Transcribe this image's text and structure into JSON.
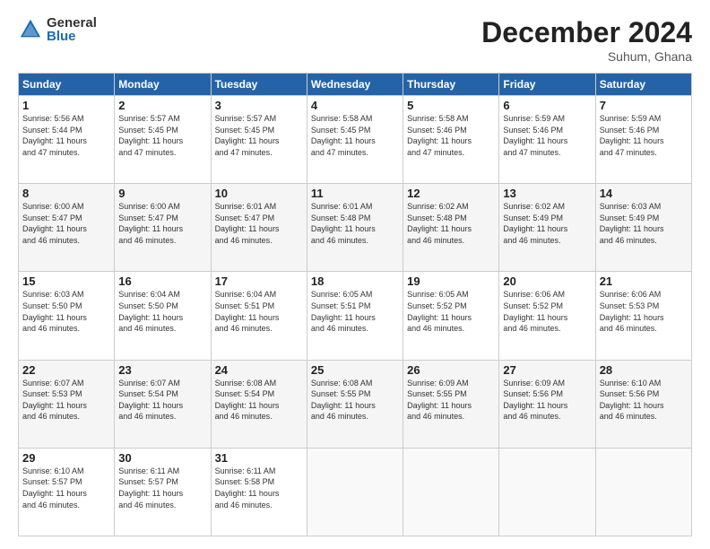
{
  "logo": {
    "general": "General",
    "blue": "Blue"
  },
  "header": {
    "month": "December 2024",
    "location": "Suhum, Ghana"
  },
  "weekdays": [
    "Sunday",
    "Monday",
    "Tuesday",
    "Wednesday",
    "Thursday",
    "Friday",
    "Saturday"
  ],
  "weeks": [
    [
      {
        "day": "1",
        "info": "Sunrise: 5:56 AM\nSunset: 5:44 PM\nDaylight: 11 hours\nand 47 minutes."
      },
      {
        "day": "2",
        "info": "Sunrise: 5:57 AM\nSunset: 5:45 PM\nDaylight: 11 hours\nand 47 minutes."
      },
      {
        "day": "3",
        "info": "Sunrise: 5:57 AM\nSunset: 5:45 PM\nDaylight: 11 hours\nand 47 minutes."
      },
      {
        "day": "4",
        "info": "Sunrise: 5:58 AM\nSunset: 5:45 PM\nDaylight: 11 hours\nand 47 minutes."
      },
      {
        "day": "5",
        "info": "Sunrise: 5:58 AM\nSunset: 5:46 PM\nDaylight: 11 hours\nand 47 minutes."
      },
      {
        "day": "6",
        "info": "Sunrise: 5:59 AM\nSunset: 5:46 PM\nDaylight: 11 hours\nand 47 minutes."
      },
      {
        "day": "7",
        "info": "Sunrise: 5:59 AM\nSunset: 5:46 PM\nDaylight: 11 hours\nand 47 minutes."
      }
    ],
    [
      {
        "day": "8",
        "info": "Sunrise: 6:00 AM\nSunset: 5:47 PM\nDaylight: 11 hours\nand 46 minutes."
      },
      {
        "day": "9",
        "info": "Sunrise: 6:00 AM\nSunset: 5:47 PM\nDaylight: 11 hours\nand 46 minutes."
      },
      {
        "day": "10",
        "info": "Sunrise: 6:01 AM\nSunset: 5:47 PM\nDaylight: 11 hours\nand 46 minutes."
      },
      {
        "day": "11",
        "info": "Sunrise: 6:01 AM\nSunset: 5:48 PM\nDaylight: 11 hours\nand 46 minutes."
      },
      {
        "day": "12",
        "info": "Sunrise: 6:02 AM\nSunset: 5:48 PM\nDaylight: 11 hours\nand 46 minutes."
      },
      {
        "day": "13",
        "info": "Sunrise: 6:02 AM\nSunset: 5:49 PM\nDaylight: 11 hours\nand 46 minutes."
      },
      {
        "day": "14",
        "info": "Sunrise: 6:03 AM\nSunset: 5:49 PM\nDaylight: 11 hours\nand 46 minutes."
      }
    ],
    [
      {
        "day": "15",
        "info": "Sunrise: 6:03 AM\nSunset: 5:50 PM\nDaylight: 11 hours\nand 46 minutes."
      },
      {
        "day": "16",
        "info": "Sunrise: 6:04 AM\nSunset: 5:50 PM\nDaylight: 11 hours\nand 46 minutes."
      },
      {
        "day": "17",
        "info": "Sunrise: 6:04 AM\nSunset: 5:51 PM\nDaylight: 11 hours\nand 46 minutes."
      },
      {
        "day": "18",
        "info": "Sunrise: 6:05 AM\nSunset: 5:51 PM\nDaylight: 11 hours\nand 46 minutes."
      },
      {
        "day": "19",
        "info": "Sunrise: 6:05 AM\nSunset: 5:52 PM\nDaylight: 11 hours\nand 46 minutes."
      },
      {
        "day": "20",
        "info": "Sunrise: 6:06 AM\nSunset: 5:52 PM\nDaylight: 11 hours\nand 46 minutes."
      },
      {
        "day": "21",
        "info": "Sunrise: 6:06 AM\nSunset: 5:53 PM\nDaylight: 11 hours\nand 46 minutes."
      }
    ],
    [
      {
        "day": "22",
        "info": "Sunrise: 6:07 AM\nSunset: 5:53 PM\nDaylight: 11 hours\nand 46 minutes."
      },
      {
        "day": "23",
        "info": "Sunrise: 6:07 AM\nSunset: 5:54 PM\nDaylight: 11 hours\nand 46 minutes."
      },
      {
        "day": "24",
        "info": "Sunrise: 6:08 AM\nSunset: 5:54 PM\nDaylight: 11 hours\nand 46 minutes."
      },
      {
        "day": "25",
        "info": "Sunrise: 6:08 AM\nSunset: 5:55 PM\nDaylight: 11 hours\nand 46 minutes."
      },
      {
        "day": "26",
        "info": "Sunrise: 6:09 AM\nSunset: 5:55 PM\nDaylight: 11 hours\nand 46 minutes."
      },
      {
        "day": "27",
        "info": "Sunrise: 6:09 AM\nSunset: 5:56 PM\nDaylight: 11 hours\nand 46 minutes."
      },
      {
        "day": "28",
        "info": "Sunrise: 6:10 AM\nSunset: 5:56 PM\nDaylight: 11 hours\nand 46 minutes."
      }
    ],
    [
      {
        "day": "29",
        "info": "Sunrise: 6:10 AM\nSunset: 5:57 PM\nDaylight: 11 hours\nand 46 minutes."
      },
      {
        "day": "30",
        "info": "Sunrise: 6:11 AM\nSunset: 5:57 PM\nDaylight: 11 hours\nand 46 minutes."
      },
      {
        "day": "31",
        "info": "Sunrise: 6:11 AM\nSunset: 5:58 PM\nDaylight: 11 hours\nand 46 minutes."
      },
      null,
      null,
      null,
      null
    ]
  ]
}
